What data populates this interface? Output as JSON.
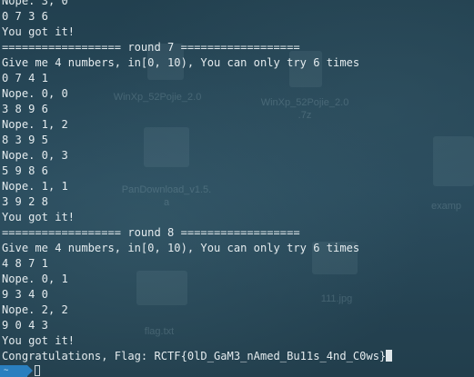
{
  "terminal": {
    "lines": [
      "Nope. 3, 0",
      "0 7 3 6",
      "You got it!",
      "================== round 7 ==================",
      "Give me 4 numbers, in[0, 10), You can only try 6 times",
      "0 7 4 1",
      "Nope. 0, 0",
      "3 8 9 6",
      "Nope. 1, 2",
      "8 3 9 5",
      "Nope. 0, 3",
      "5 9 8 6",
      "Nope. 1, 1",
      "3 9 2 8",
      "You got it!",
      "================== round 8 ==================",
      "Give me 4 numbers, in[0, 10), You can only try 6 times",
      "4 8 7 1",
      "Nope. 0, 1",
      "9 3 4 0",
      "Nope. 2, 2",
      "9 0 4 3",
      "You got it!",
      "Congratulations, Flag: RCTF{0lD_GaM3_nAmed_Bu11s_4nd_C0ws}"
    ],
    "prompt_label": "~"
  },
  "desktop_background": {
    "icons": [
      {
        "label_1": "WinXp_52Pojie_2.0",
        "label_2": ""
      },
      {
        "label_1": "WinXp_52Pojie_2.0",
        "label_2": ".7z"
      },
      {
        "label_1": "PanDownload_v1.5.",
        "label_2": "a"
      },
      {
        "label_1": "examp",
        "label_2": ""
      },
      {
        "label_1": "111.jpg",
        "label_2": ""
      },
      {
        "label_1": "flag.txt",
        "label_2": ""
      }
    ]
  },
  "colors": {
    "background": "#24414f",
    "text": "#e4ebee",
    "prompt_tag": "#2a7fbf"
  }
}
